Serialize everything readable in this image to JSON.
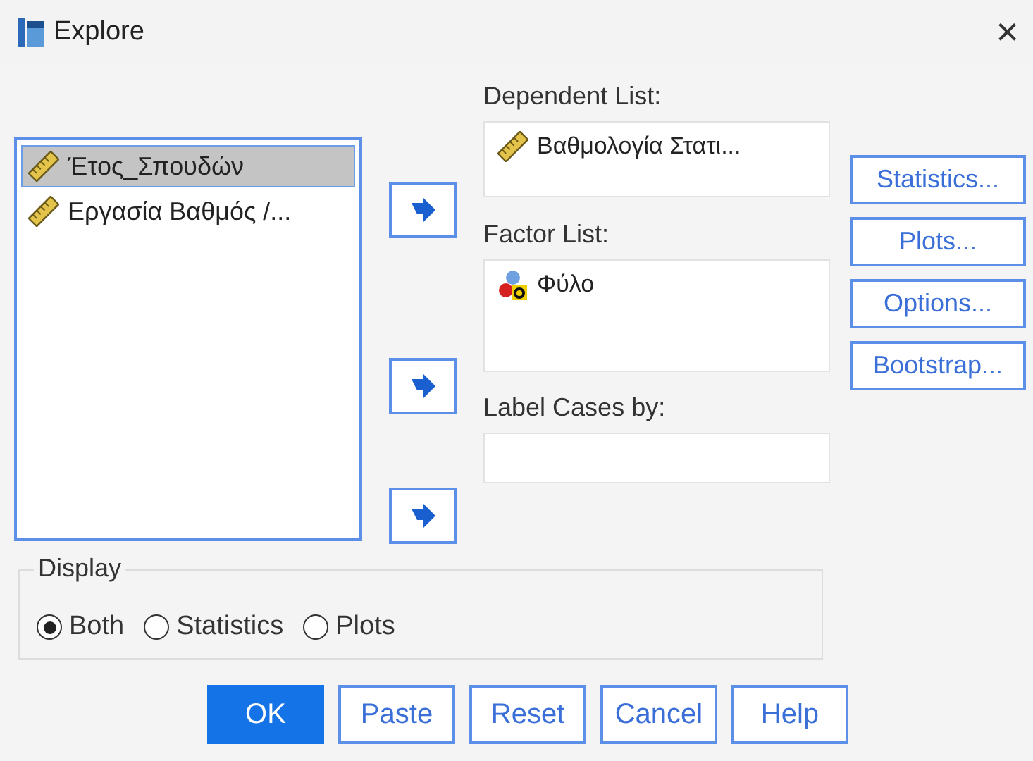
{
  "window": {
    "title": "Explore",
    "close": "×"
  },
  "variables": [
    {
      "name": "Έτος_Σπουδών",
      "kind": "scale",
      "selected": true
    },
    {
      "name": "Εργασία Βαθμός /...",
      "kind": "scale",
      "selected": false
    }
  ],
  "dependent_list": {
    "label": "Dependent List:",
    "items": [
      {
        "name": "Βαθμολογία Στατι...",
        "kind": "scale"
      }
    ]
  },
  "factor_list": {
    "label": "Factor List:",
    "items": [
      {
        "name": "Φύλο",
        "kind": "nominal"
      }
    ]
  },
  "label_cases": {
    "label": "Label Cases by:"
  },
  "side_buttons": [
    {
      "label": "Statistics..."
    },
    {
      "label": "Plots..."
    },
    {
      "label": "Options..."
    },
    {
      "label": "Bootstrap..."
    }
  ],
  "display": {
    "title": "Display",
    "options": [
      {
        "label": "Both",
        "selected": true
      },
      {
        "label": "Statistics",
        "selected": false
      },
      {
        "label": "Plots",
        "selected": false
      }
    ]
  },
  "buttons": [
    {
      "label": "OK",
      "primary": true
    },
    {
      "label": "Paste",
      "primary": false
    },
    {
      "label": "Reset",
      "primary": false
    },
    {
      "label": "Cancel",
      "primary": false
    },
    {
      "label": "Help",
      "primary": false
    }
  ]
}
